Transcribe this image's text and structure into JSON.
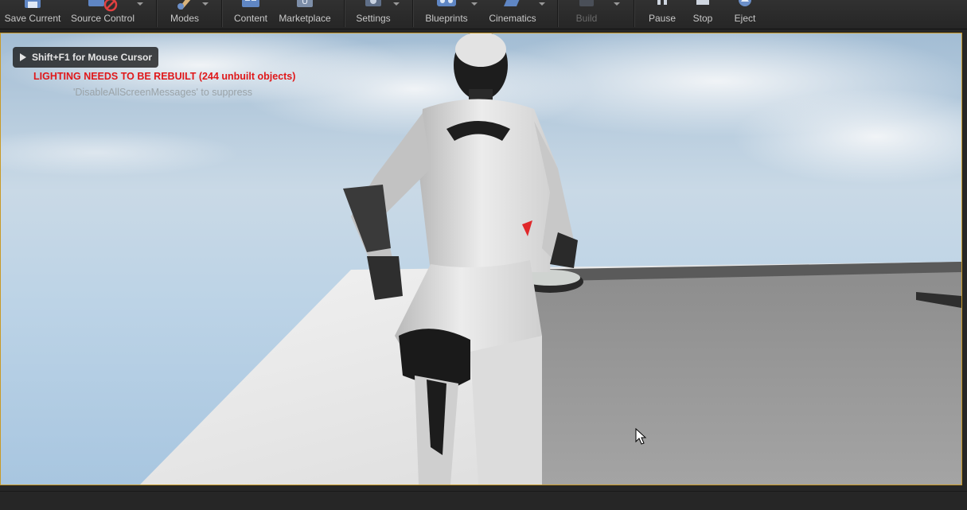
{
  "toolbar": {
    "save_current": "Save Current",
    "source_control": "Source Control",
    "modes": "Modes",
    "content": "Content",
    "marketplace": "Marketplace",
    "settings": "Settings",
    "blueprints": "Blueprints",
    "cinematics": "Cinematics",
    "build": "Build",
    "pause": "Pause",
    "stop": "Stop",
    "eject": "Eject"
  },
  "viewport": {
    "cursor_hint": "Shift+F1 for Mouse Cursor",
    "lighting_warning": "LIGHTING NEEDS TO BE REBUILT (244 unbuilt objects)",
    "suppress_hint": "'DisableAllScreenMessages' to suppress"
  },
  "colors": {
    "warning_red": "#e0181a",
    "viewport_border": "#c99a27",
    "toolbar_bg": "#2b2b2b"
  }
}
